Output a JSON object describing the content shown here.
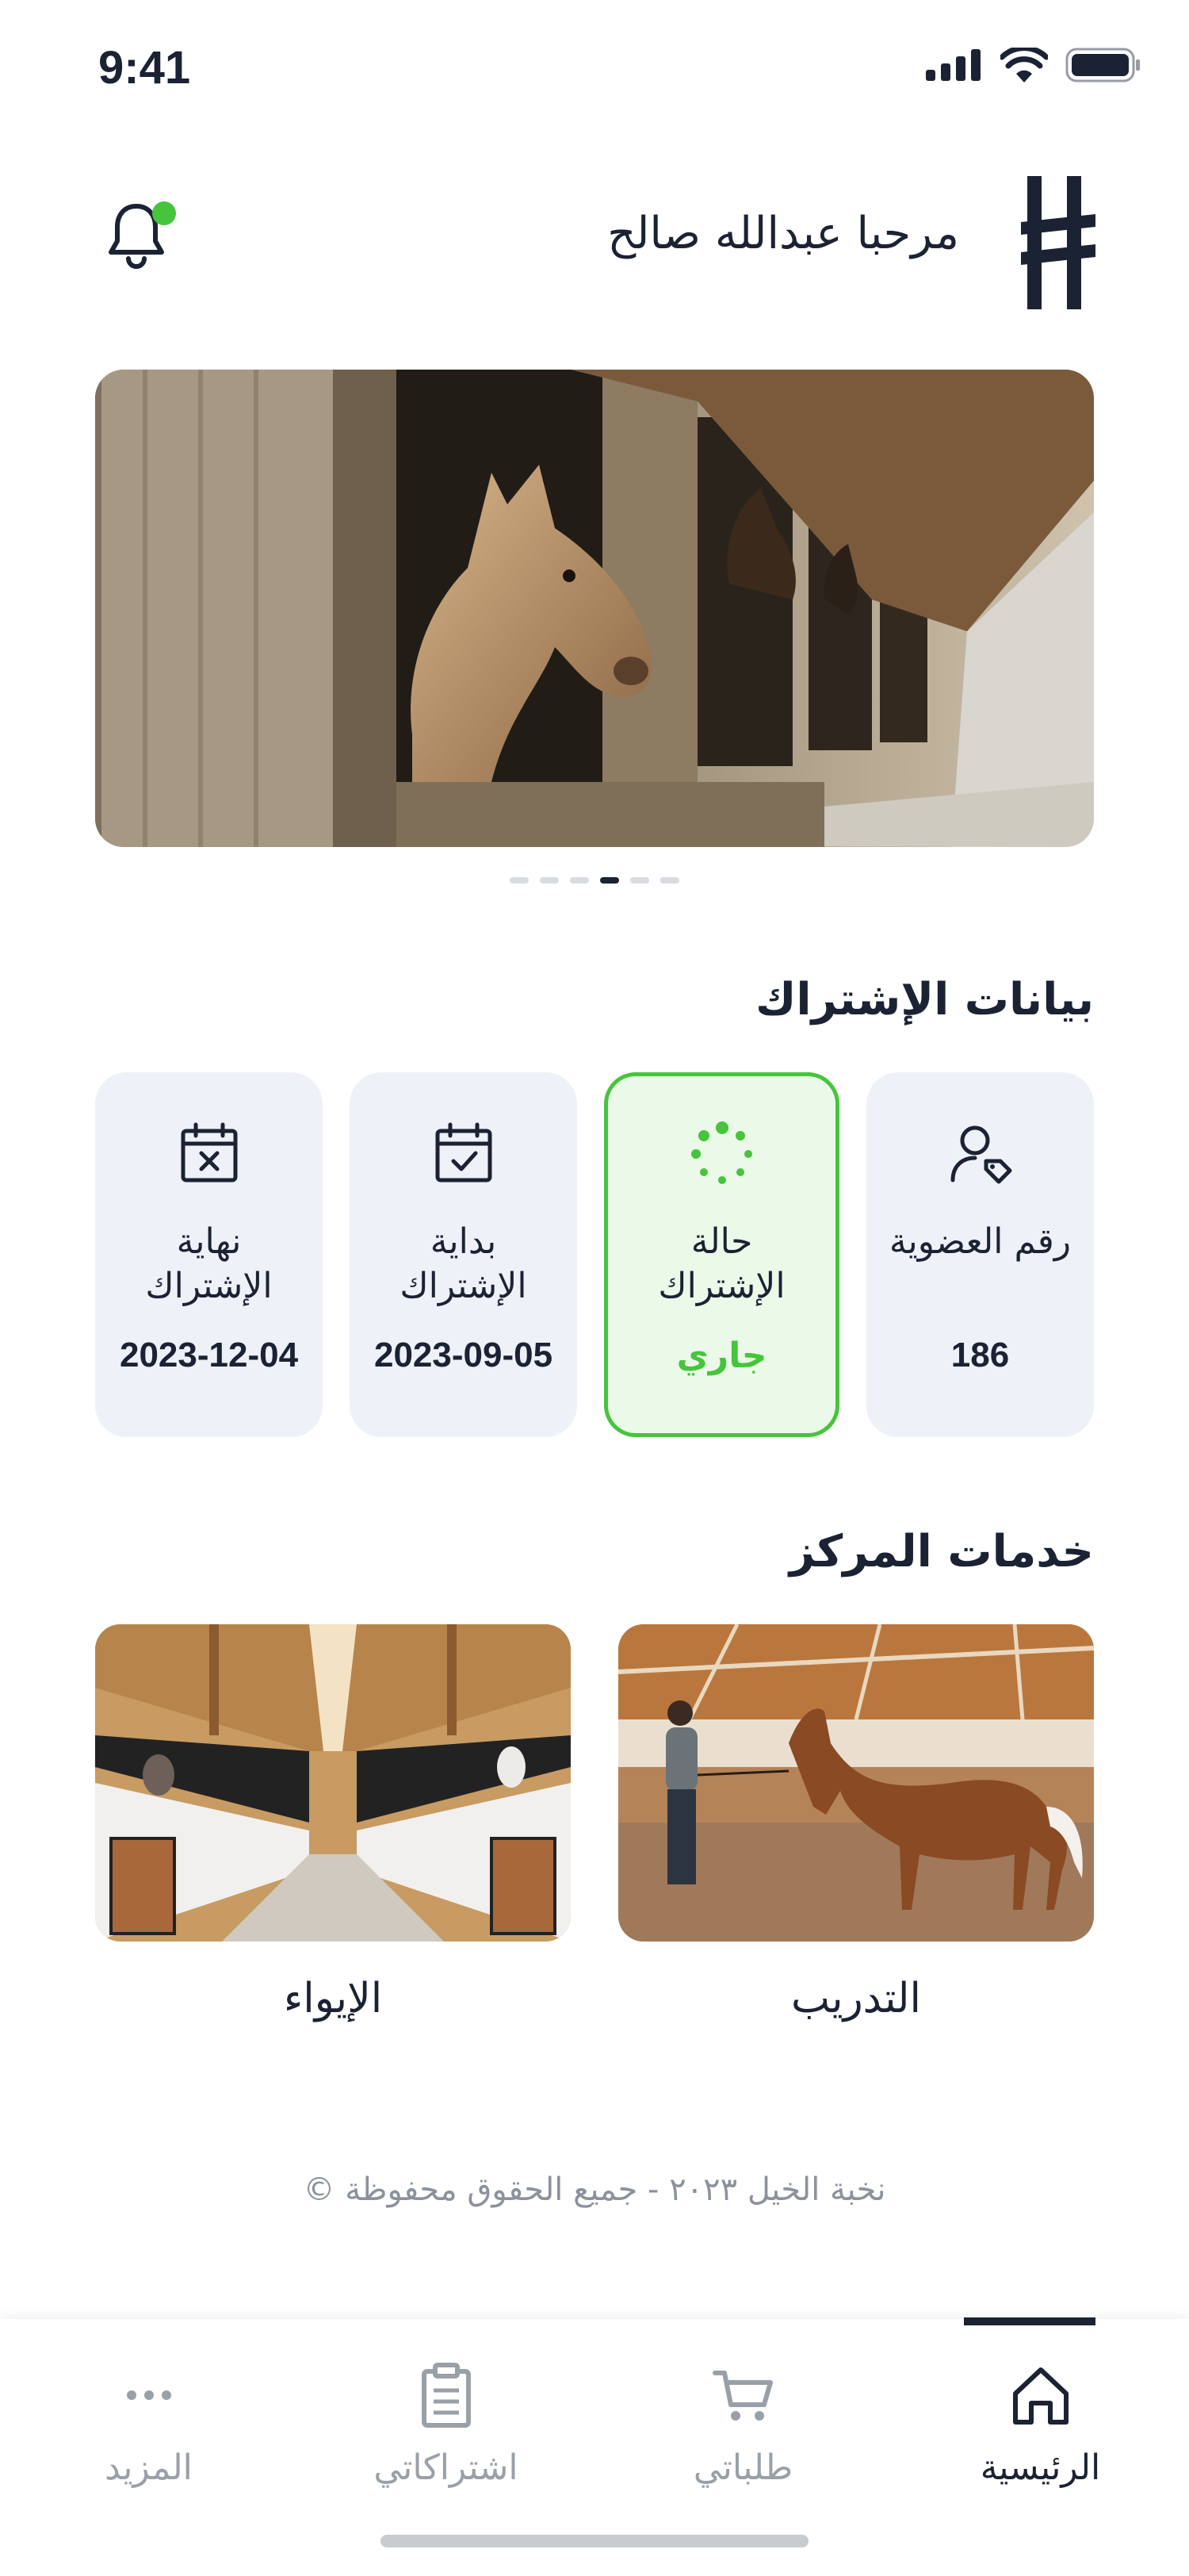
{
  "status_bar": {
    "time": "9:41"
  },
  "header": {
    "greeting": "مرحبا عبدالله صالح"
  },
  "carousel": {
    "page_count": 6,
    "active_index": 3
  },
  "subscription": {
    "title": "بيانات الإشتراك",
    "cards": [
      {
        "label": "رقم العضوية",
        "value": "186",
        "icon": "user-tag-icon"
      },
      {
        "label": "حالة الإشتراك",
        "value": "جاري",
        "icon": "loading-icon",
        "active": true
      },
      {
        "label": "بداية الإشتراك",
        "value": "2023-09-05",
        "icon": "calendar-check-icon"
      },
      {
        "label": "نهاية الإشتراك",
        "value": "2023-12-04",
        "icon": "calendar-x-icon"
      }
    ]
  },
  "services": {
    "title": "خدمات المركز",
    "items": [
      {
        "label": "التدريب"
      },
      {
        "label": "الإيواء"
      }
    ]
  },
  "footer": {
    "text": "نخبة الخيل ٢٠٢٣ - جميع الحقوق محفوظة ©"
  },
  "tabbar": {
    "items": [
      {
        "label": "الرئيسية",
        "icon": "home-icon",
        "active": true
      },
      {
        "label": "طلباتي",
        "icon": "cart-icon"
      },
      {
        "label": "اشتراكاتي",
        "icon": "clipboard-icon"
      },
      {
        "label": "المزيد",
        "icon": "more-icon"
      }
    ]
  },
  "colors": {
    "accent_green": "#46c43c",
    "dark": "#1b2233",
    "card_bg": "#eef1f8"
  }
}
